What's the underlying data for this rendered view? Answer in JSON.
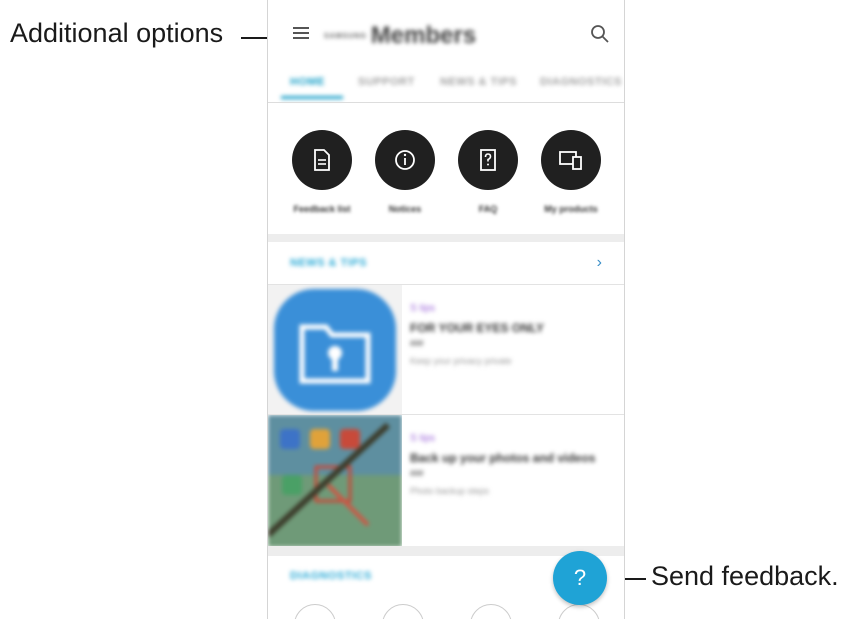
{
  "callouts": {
    "additional_options": "Additional options",
    "send_feedback": "Send feedback."
  },
  "app": {
    "brand": "SAMSUNG",
    "title": "Members"
  },
  "tabs": [
    {
      "label": "HOME",
      "active": true
    },
    {
      "label": "SUPPORT",
      "active": false
    },
    {
      "label": "NEWS & TIPS",
      "active": false
    },
    {
      "label": "DIAGNOSTICS",
      "active": false
    }
  ],
  "quick_actions": [
    {
      "label": "Feedback list",
      "icon": "document-icon"
    },
    {
      "label": "Notices",
      "icon": "info-icon"
    },
    {
      "label": "FAQ",
      "icon": "question-book-icon"
    },
    {
      "label": "My products",
      "icon": "devices-icon"
    }
  ],
  "news_section": {
    "title": "NEWS & TIPS",
    "more_icon": "chevron-right-icon"
  },
  "cards": [
    {
      "category": "S tips",
      "title": "FOR YOUR EYES ONLY",
      "meta": "###",
      "description": "Keep your privacy private"
    },
    {
      "category": "S tips",
      "title": "Back up your photos and videos",
      "meta": "###",
      "description": "Photo backup steps"
    }
  ],
  "diagnostics_section": {
    "title": "DIAGNOSTICS"
  },
  "fab": {
    "label": "?",
    "icon": "help-icon"
  },
  "colors": {
    "accent": "#1aa0c8",
    "fab": "#1fa3d6",
    "category": "#9a63d8",
    "circle_dark": "#202020"
  }
}
